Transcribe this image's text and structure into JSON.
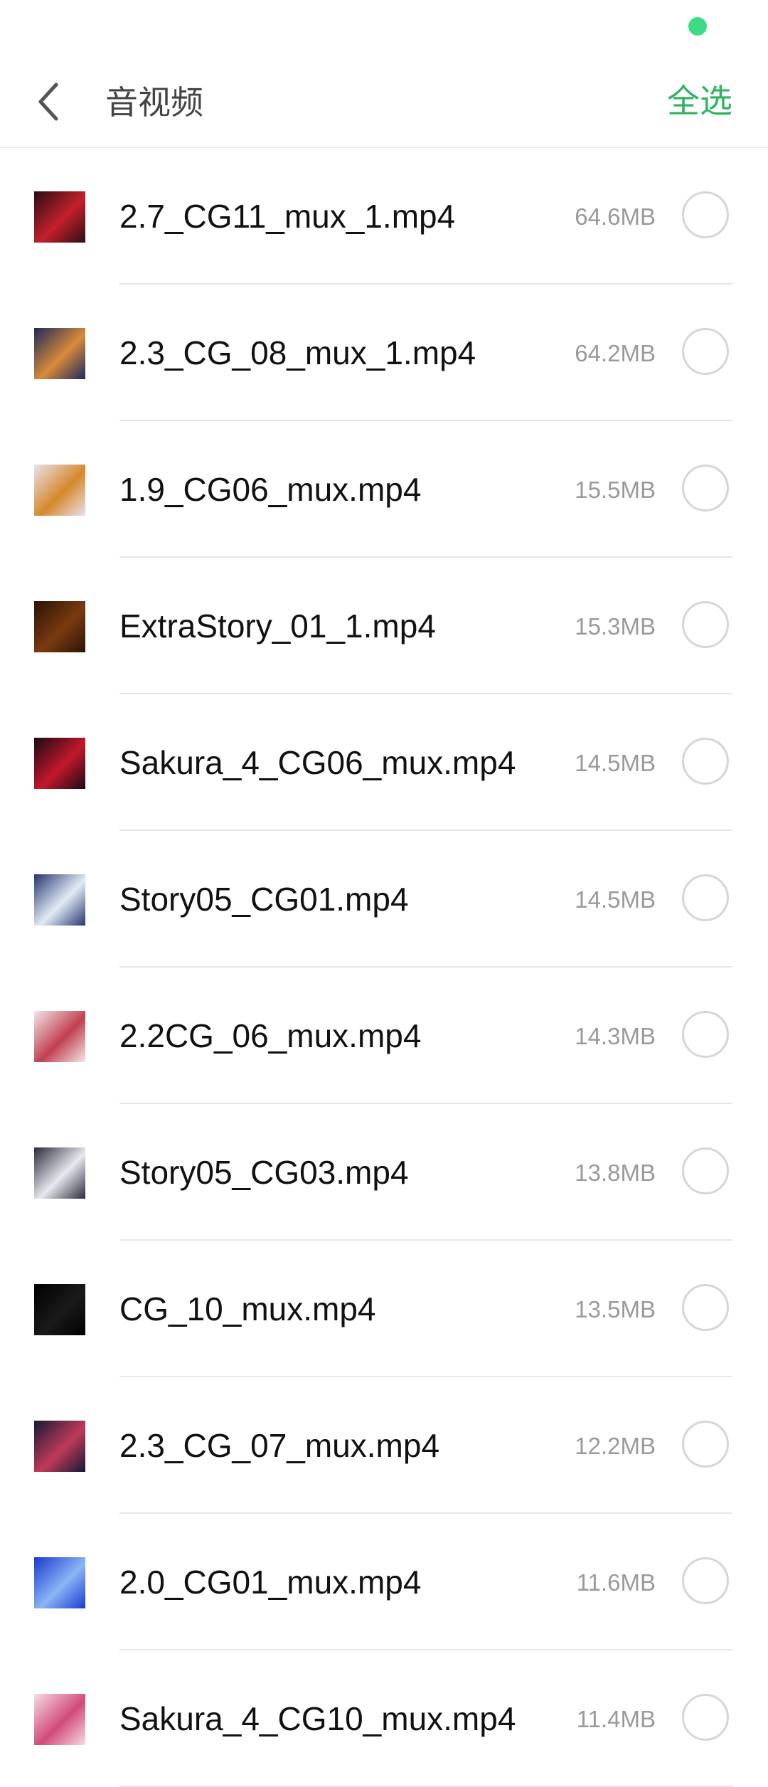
{
  "status_bar": {
    "indicator_color": "#3ddc84"
  },
  "header": {
    "back_icon": "chevron-left-icon",
    "title": "音视频",
    "select_all_label": "全选",
    "accent_color": "#2eb35e"
  },
  "files": [
    {
      "name": "2.7_CG11_mux_1.mp4",
      "size": "64.6MB",
      "thumb_colors": [
        "#2a0d12",
        "#c4202c"
      ]
    },
    {
      "name": "2.3_CG_08_mux_1.mp4",
      "size": "64.2MB",
      "thumb_colors": [
        "#1b2a5c",
        "#d88a3a"
      ]
    },
    {
      "name": "1.9_CG06_mux.mp4",
      "size": "15.5MB",
      "thumb_colors": [
        "#e8e2ea",
        "#d6882c"
      ]
    },
    {
      "name": "ExtraStory_01_1.mp4",
      "size": "15.3MB",
      "thumb_colors": [
        "#2a1406",
        "#7a3a10"
      ]
    },
    {
      "name": "Sakura_4_CG06_mux.mp4",
      "size": "14.5MB",
      "thumb_colors": [
        "#1a0a14",
        "#c2182c"
      ]
    },
    {
      "name": "Story05_CG01.mp4",
      "size": "14.5MB",
      "thumb_colors": [
        "#24356e",
        "#e2ecf6"
      ]
    },
    {
      "name": "2.2CG_06_mux.mp4",
      "size": "14.3MB",
      "thumb_colors": [
        "#f4e6e8",
        "#c04050"
      ]
    },
    {
      "name": "Story05_CG03.mp4",
      "size": "13.8MB",
      "thumb_colors": [
        "#2a2a3a",
        "#e8e8f0"
      ]
    },
    {
      "name": "CG_10_mux.mp4",
      "size": "13.5MB",
      "thumb_colors": [
        "#000000",
        "#1a1a1a"
      ]
    },
    {
      "name": "2.3_CG_07_mux.mp4",
      "size": "12.2MB",
      "thumb_colors": [
        "#141a36",
        "#c03a5a"
      ]
    },
    {
      "name": "2.0_CG01_mux.mp4",
      "size": "11.6MB",
      "thumb_colors": [
        "#1a3ad0",
        "#8ab6f4"
      ]
    },
    {
      "name": "Sakura_4_CG10_mux.mp4",
      "size": "11.4MB",
      "thumb_colors": [
        "#f6dce4",
        "#d04a7a"
      ]
    }
  ]
}
